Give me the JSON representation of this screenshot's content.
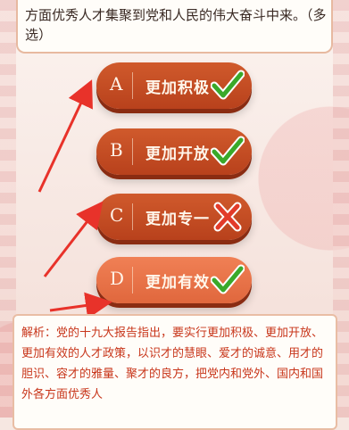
{
  "question": {
    "text": "方面优秀人才集聚到党和人民的伟大奋斗中来。（多选）"
  },
  "options": [
    {
      "letter": "A",
      "label": "更加积极",
      "status": "correct"
    },
    {
      "letter": "B",
      "label": "更加开放",
      "status": "correct"
    },
    {
      "letter": "C",
      "label": "更加专一",
      "status": "wrong"
    },
    {
      "letter": "D",
      "label": "更加有效",
      "status": "correct"
    }
  ],
  "analysis": {
    "text": "解析：党的十九大报告指出，要实行更加积极、更加开放、更加有效的人才政策，以识才的慧眼、爱才的诚意、用才的胆识、容才的雅量、聚才的良方，把党内和党外、国内和国外各方面优秀人"
  },
  "colors": {
    "option_red": "#b8411c",
    "option_selected": "#e0673d",
    "check_green": "#3aa92a",
    "cross_red": "#e23b2a",
    "arrow_red": "#e8322a",
    "analysis_text": "#c8361b"
  },
  "icons": {
    "correct": "check-icon",
    "wrong": "cross-icon"
  }
}
